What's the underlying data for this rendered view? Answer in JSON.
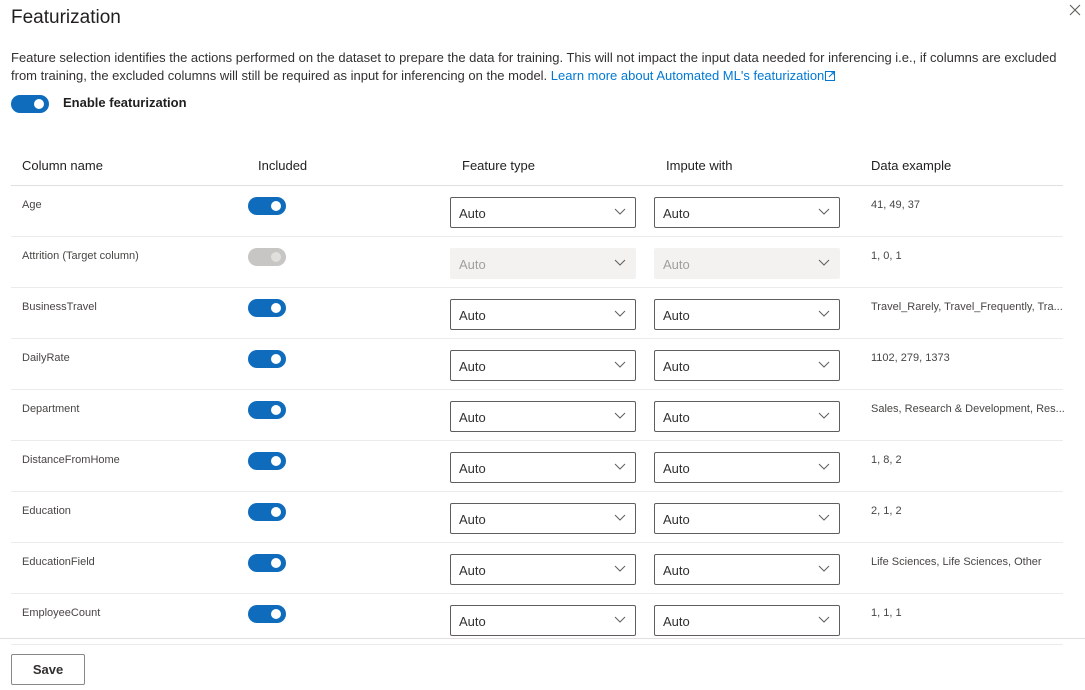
{
  "dialog": {
    "title": "Featurization",
    "description": "Feature selection identifies the actions performed on the dataset to prepare the data for training. This will not impact the input data needed for inferencing i.e., if columns are excluded from training, the excluded columns will still be required as input for inferencing on the model.",
    "learn_more_link": "Learn more about Automated ML's featurization",
    "enable_label": "Enable featurization",
    "enable_on": true,
    "save_label": "Save",
    "accent_color": "#0f6cbd"
  },
  "table": {
    "headers": {
      "column_name": "Column name",
      "included": "Included",
      "feature_type": "Feature type",
      "impute_with": "Impute with",
      "data_example": "Data example"
    },
    "rows": [
      {
        "name": "Age",
        "included": true,
        "disabled": false,
        "feature_type": "Auto",
        "impute_with": "Auto",
        "example": "41, 49, 37"
      },
      {
        "name": "Attrition (Target column)",
        "included": true,
        "disabled": true,
        "feature_type": "Auto",
        "impute_with": "Auto",
        "example": "1, 0, 1"
      },
      {
        "name": "BusinessTravel",
        "included": true,
        "disabled": false,
        "feature_type": "Auto",
        "impute_with": "Auto",
        "example": "Travel_Rarely, Travel_Frequently, Tra..."
      },
      {
        "name": "DailyRate",
        "included": true,
        "disabled": false,
        "feature_type": "Auto",
        "impute_with": "Auto",
        "example": "1102, 279, 1373"
      },
      {
        "name": "Department",
        "included": true,
        "disabled": false,
        "feature_type": "Auto",
        "impute_with": "Auto",
        "example": "Sales, Research & Development, Res..."
      },
      {
        "name": "DistanceFromHome",
        "included": true,
        "disabled": false,
        "feature_type": "Auto",
        "impute_with": "Auto",
        "example": "1, 8, 2"
      },
      {
        "name": "Education",
        "included": true,
        "disabled": false,
        "feature_type": "Auto",
        "impute_with": "Auto",
        "example": "2, 1, 2"
      },
      {
        "name": "EducationField",
        "included": true,
        "disabled": false,
        "feature_type": "Auto",
        "impute_with": "Auto",
        "example": "Life Sciences, Life Sciences, Other"
      },
      {
        "name": "EmployeeCount",
        "included": true,
        "disabled": false,
        "feature_type": "Auto",
        "impute_with": "Auto",
        "example": "1, 1, 1"
      }
    ]
  }
}
